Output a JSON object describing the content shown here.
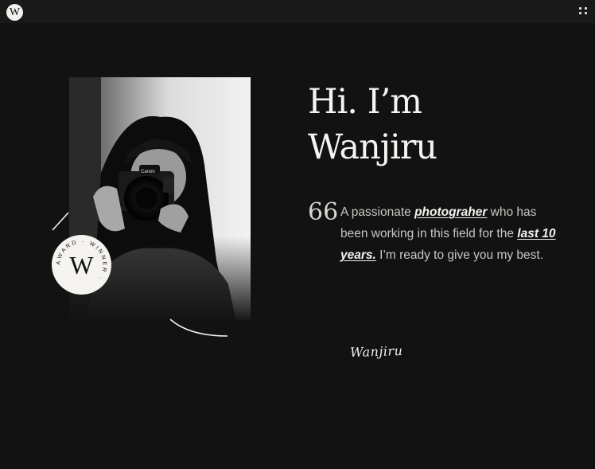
{
  "header": {
    "logo_letter": "W",
    "menu_icon": "grid-dots-icon"
  },
  "hero": {
    "title_line1": "Hi. I’m",
    "title_line2": "Wanjiru",
    "quote_glyph": "66",
    "bio_part1": "A passionate ",
    "bio_link1": "photograher",
    "bio_part2": " who has been working in this field for the ",
    "bio_link2": "last 10 years.",
    "bio_part3": " I’m ready to give you my best.",
    "signature": "Wanjiru"
  },
  "badge": {
    "letter": "W",
    "ring_text": "AWARD · WINNER ·"
  },
  "photo": {
    "subject": "woman holding camera",
    "camera_brand": "Canon"
  },
  "colors": {
    "background": "#131213",
    "topbar": "#1a1919",
    "text": "#f4f2ee",
    "muted_text": "#c9c6c1"
  }
}
